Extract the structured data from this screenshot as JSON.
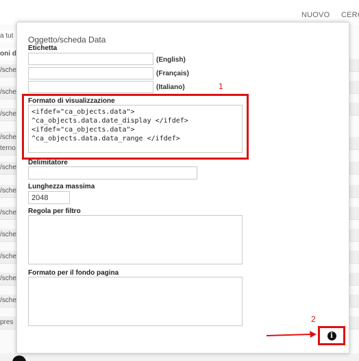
{
  "background": {
    "nav": {
      "nuovo": "NUOVO",
      "cerca": "CERC"
    },
    "left_rows": [
      "a tut",
      "oni d",
      "/sche",
      "/sche",
      "/sche",
      "/sche",
      "terno",
      "/sche",
      "/sche",
      "/sche",
      "/sche",
      "/sche",
      "/sche",
      "/sche",
      "pres"
    ]
  },
  "modal": {
    "title": "Oggetto/scheda Data",
    "etichetta": {
      "label": "Etichetta",
      "languages": [
        {
          "lang": "(English)",
          "value": ""
        },
        {
          "lang": "(Français)",
          "value": ""
        },
        {
          "lang": "(Italiano)",
          "value": ""
        }
      ]
    },
    "formato_visualizzazione": {
      "label": "Formato di visualizzazione",
      "lines": [
        "<ifdef=\"ca_objects.data\">",
        "^ca_objects.data.date_display </ifdef>",
        "<ifdef=\"ca_objects.data\">",
        "^ca_objects.data.data_range </ifdef>"
      ]
    },
    "delimitatore": {
      "label": "Delimitatore",
      "value": ""
    },
    "lunghezza_massima": {
      "label": "Lunghezza massima",
      "value": "2048"
    },
    "regola_filtro": {
      "label": "Regola per filtro",
      "value": ""
    },
    "formato_fondo": {
      "label": "Formato per il fondo pagina",
      "value": ""
    },
    "info_icon": "info-circle-icon"
  },
  "annotations": {
    "marker_1": "1",
    "marker_2": "2",
    "color": "#dd1111"
  }
}
